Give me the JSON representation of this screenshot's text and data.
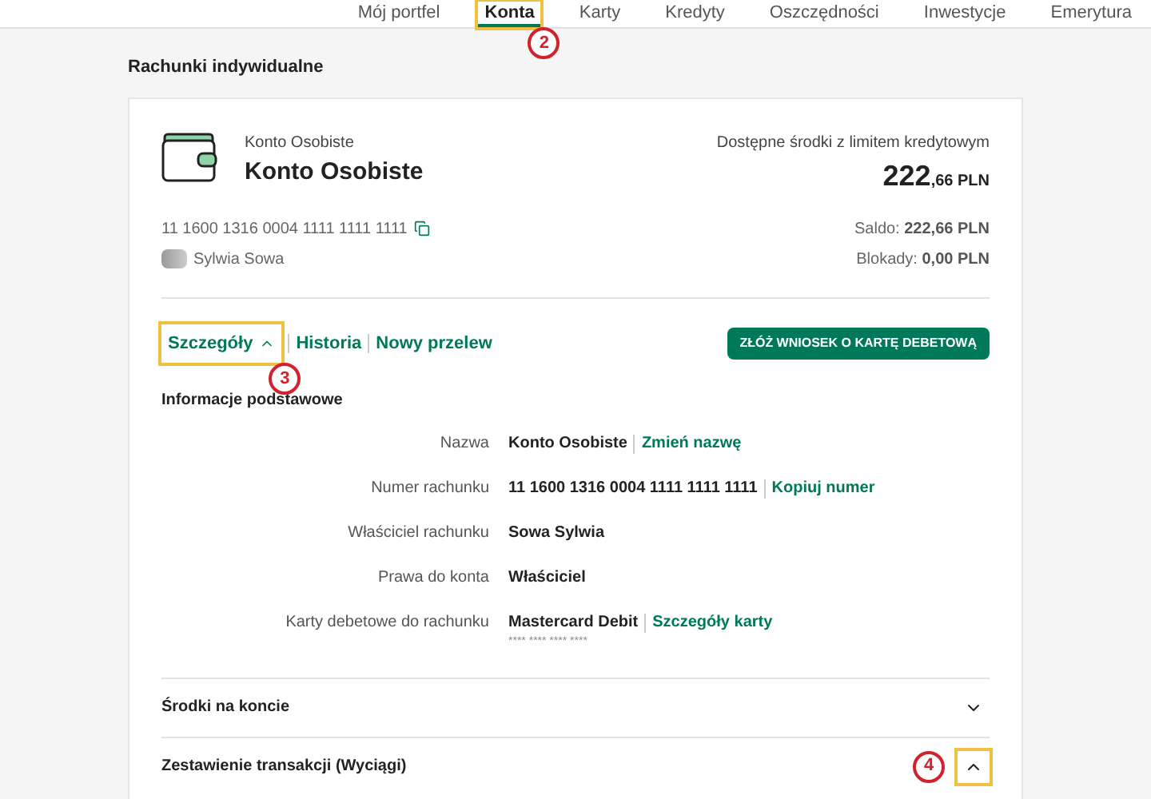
{
  "nav": {
    "items": [
      {
        "label": "Mój portfel",
        "selected": false
      },
      {
        "label": "Konta",
        "selected": true,
        "callout": "2"
      },
      {
        "label": "Karty",
        "selected": false
      },
      {
        "label": "Kredyty",
        "selected": false
      },
      {
        "label": "Oszczędności",
        "selected": false
      },
      {
        "label": "Inwestycje",
        "selected": false
      },
      {
        "label": "Emerytura",
        "selected": false
      }
    ]
  },
  "section_title": "Rachunki indywidualne",
  "account": {
    "type": "Konto Osobiste",
    "name": "Konto Osobiste",
    "number": "11 1600 1316 0004 1111 1111 1111",
    "owner": "Sylwia Sowa",
    "available_label": "Dostępne środki z limitem kredytowym",
    "available_int": "222",
    "available_dec": ",66 PLN",
    "saldo_label": "Saldo:",
    "saldo": "222,66 PLN",
    "blokady_label": "Blokady:",
    "blokady": "0,00 PLN"
  },
  "links": [
    {
      "label": "Szczegóły",
      "selected": true,
      "callout": "3"
    },
    {
      "label": "Historia",
      "selected": false
    },
    {
      "label": "Nowy przelew",
      "selected": false
    }
  ],
  "card_button": "ZŁÓŻ WNIOSEK O KARTĘ DEBETOWĄ",
  "info": {
    "title": "Informacje podstawowe",
    "rows": [
      {
        "label": "Nazwa",
        "value": "Konto Osobiste",
        "link": "Zmień nazwę"
      },
      {
        "label": "Numer rachunku",
        "value": "11 1600 1316 0004 1111 1111 1111",
        "link": "Kopiuj numer"
      },
      {
        "label": "Właściciel rachunku",
        "value": "Sowa Sylwia"
      },
      {
        "label": "Prawa do konta",
        "value": "Właściciel"
      },
      {
        "label": "Karty debetowe do rachunku",
        "value": "Mastercard Debit",
        "link": "Szczegóły karty",
        "sub": "**** **** **** ****"
      }
    ]
  },
  "sections": [
    {
      "title": "Środki na koncie",
      "expanded": false
    },
    {
      "title": "Zestawienie transakcji (Wyciągi)",
      "expanded": true,
      "callout": "4"
    }
  ]
}
